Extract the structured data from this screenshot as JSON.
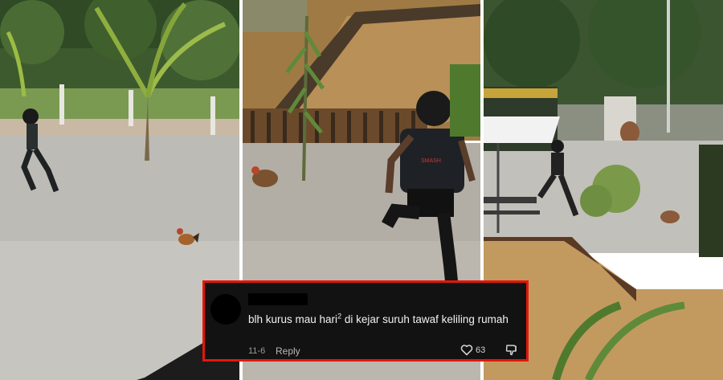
{
  "panels": [
    {
      "scene": "runner-on-gravel-chasing-rooster"
    },
    {
      "scene": "runner-by-pond-with-rooster"
    },
    {
      "scene": "runner-in-garden-with-rooster"
    }
  ],
  "comment": {
    "text_main": "blh kurus mau hari",
    "text_sup": "2",
    "text_rest": " di kejar suruh tawaf keliling rumah",
    "date": "11-6",
    "reply_label": "Reply",
    "likes": "63",
    "border_color": "#e3170a",
    "icons": [
      "heart-icon",
      "thumbs-down-icon"
    ]
  }
}
